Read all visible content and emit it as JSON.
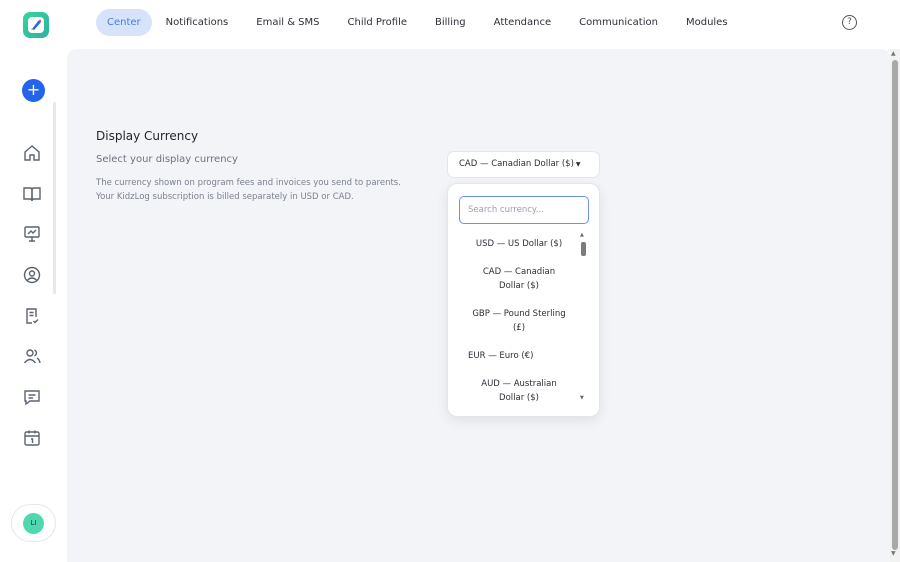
{
  "nav": {
    "tabs": [
      {
        "label": "Center",
        "active": true
      },
      {
        "label": "Notifications",
        "active": false
      },
      {
        "label": "Email & SMS",
        "active": false
      },
      {
        "label": "Child Profile",
        "active": false
      },
      {
        "label": "Billing",
        "active": false
      },
      {
        "label": "Attendance",
        "active": false
      },
      {
        "label": "Communication",
        "active": false
      },
      {
        "label": "Modules",
        "active": false
      }
    ],
    "help_glyph": "?"
  },
  "sidebar": {
    "add_glyph": "+",
    "icons": [
      "home-icon",
      "book-icon",
      "presentation-icon",
      "profile-icon",
      "checklist-icon",
      "users-icon",
      "chat-icon",
      "calendar-icon"
    ],
    "avatar_initials": "LI"
  },
  "settings": {
    "title": "Display Currency",
    "subtitle": "Select your display currency",
    "description_line1": "The currency shown on program fees and invoices you send to parents.",
    "description_line2": "Your KidzLog subscription is billed separately in USD or CAD."
  },
  "currency_select": {
    "selected": "CAD — Canadian Dollar ($)",
    "caret": "▼",
    "search_placeholder": "Search currency...",
    "options": [
      "USD — US Dollar ($)",
      "CAD — Canadian Dollar ($)",
      "GBP — Pound Sterling (£)",
      "EUR — Euro (€)",
      "AUD — Australian Dollar ($)"
    ]
  },
  "colors": {
    "accent": "#2463eb",
    "active_tab_bg": "#d7e3fb",
    "active_tab_text": "#4a78e8",
    "panel_bg": "#f2f4f8",
    "logo": "#38d39f",
    "avatar": "#4fd8b0"
  }
}
